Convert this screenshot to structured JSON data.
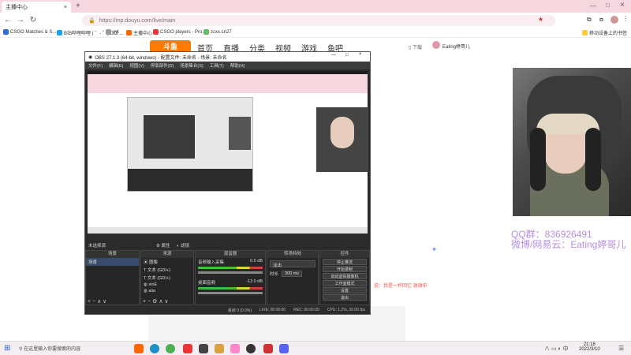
{
  "browser": {
    "tab_title": "主播中心",
    "url": "https://mp.douyu.com/live/main",
    "new_tab": "+",
    "bookmarks": [
      {
        "label": "CSGO Matches & S..."
      },
      {
        "label": "B站哔哩哔哩 ( ゜- ゜)つロ ..."
      },
      {
        "label": "yyt"
      },
      {
        "label": "主播中心"
      },
      {
        "label": "CSGO players - Pro..."
      },
      {
        "label": "zcxx.cn27"
      }
    ],
    "mobile_bookmarks": "移动设备上的书签"
  },
  "douyu": {
    "logo": "斗鱼",
    "nav": [
      "首页",
      "直播",
      "分类",
      "视频",
      "游戏",
      "鱼吧"
    ],
    "download": "下载",
    "username": "Eating婷哥儿"
  },
  "obs": {
    "title": "OBS 27.1.3 (64-bit, windows) - 配置文件: 未命名 - 场景: 未命名",
    "menu": [
      "文件(F)",
      "编辑(E)",
      "视图(V)",
      "停靠部件(D)",
      "场景集合(S)",
      "工具(T)",
      "帮助(H)"
    ],
    "no_source": "未选择源",
    "props": "属性",
    "filters": "滤镜",
    "docks": {
      "scenes": "场景",
      "sources": "来源",
      "mixer": "混音器",
      "transitions": "转场特效",
      "controls": "控件"
    },
    "scene_item": "场景",
    "sources": [
      "图像",
      "文本 (GDI+)",
      "文本 (GDI+)",
      "xinE",
      "aiia"
    ],
    "mixer_channels": [
      {
        "name": "音频输入采集",
        "db": "0.0 dB"
      },
      {
        "name": "桌面音频",
        "db": "-12.0 dB"
      }
    ],
    "transition": "淡出",
    "duration_label": "时长",
    "duration": "300 ms",
    "controls": [
      "停止推流",
      "开始录制",
      "启动虚拟摄像机",
      "工作室模式",
      "设置",
      "退出"
    ],
    "status": {
      "drop": "丢帧 0 (0.0%)",
      "live": "LIVE: 00:00:00",
      "rec": "REC: 00:00:00",
      "cpu": "CPU: 1.2%, 30.00 fps"
    }
  },
  "right_panel": {
    "qq": "QQ群：836926491",
    "weibo": "微博/网易云：Eating婷哥儿",
    "small_text": "说：我是一杯回忆 谢谢中"
  },
  "taskbar": {
    "search_placeholder": "在这里输入你要搜索的内容",
    "time": "21:18",
    "date": "2022/3/10"
  }
}
